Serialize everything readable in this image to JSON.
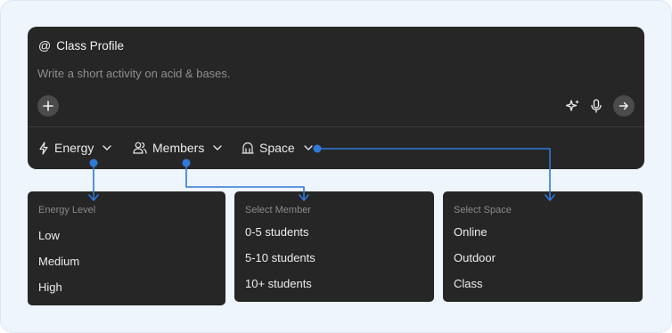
{
  "composer": {
    "title": "Class Profile",
    "placeholder": "Write a short activity on acid & bases."
  },
  "filters": {
    "energy": "Energy",
    "members": "Members",
    "space": "Space"
  },
  "panels": {
    "energy": {
      "heading": "Energy Level",
      "options": [
        "Low",
        "Medium",
        "High"
      ]
    },
    "members": {
      "heading": "Select Member",
      "options": [
        "0-5 students",
        "5-10 students",
        "10+ students"
      ]
    },
    "space": {
      "heading": "Select Space",
      "options": [
        "Online",
        "Outdoor",
        "Class"
      ]
    }
  },
  "colors": {
    "background": "#eef5fc",
    "surface": "#262626",
    "connector": "#2f7ad8"
  },
  "icons": [
    "at-icon",
    "plus-icon",
    "sparkle-icon",
    "microphone-icon",
    "arrow-right-icon",
    "lightning-icon",
    "users-icon",
    "building-icon",
    "chevron-down-icon"
  ]
}
